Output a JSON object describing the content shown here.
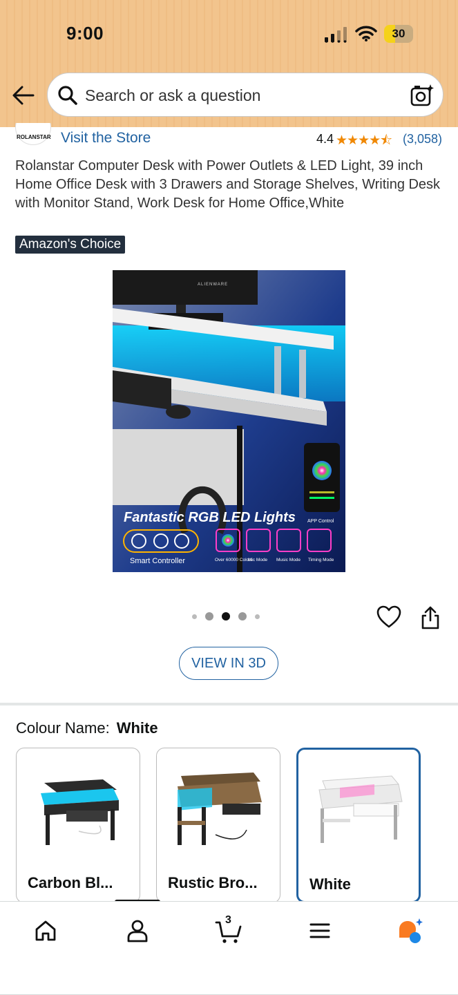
{
  "status_bar": {
    "time": "9:00",
    "battery": "30"
  },
  "search": {
    "placeholder": "Search or ask a question"
  },
  "store": {
    "logo_text": "ROLANSTAR",
    "link": "Visit the Store",
    "rating": "4.4",
    "stars": "★★★★⯪",
    "review_count": "(3,058)"
  },
  "product": {
    "title": "Rolanstar Computer Desk with Power Outlets & LED Light, 39 inch Home Office Desk with 3 Drawers and Storage Shelves, Writing Desk with Monitor Stand, Work Desk for Home Office,White",
    "badge": "Amazon's Choice"
  },
  "image": {
    "monitor_brand": "ALIENWARE",
    "headline": "Fantastic RGB LED Lights",
    "smart_controller": "Smart Controller",
    "app_control": "APP Control",
    "features": [
      "Over 60000 Colors",
      "Mic Mode",
      "Music Mode",
      "Timing Mode"
    ]
  },
  "carousel": {
    "count": 5,
    "active_index": 2
  },
  "view_3d": "VIEW IN 3D",
  "colour": {
    "label": "Colour Name:",
    "selected": "White",
    "options": [
      {
        "label": "Carbon Bl...",
        "color": "#2b2b2b"
      },
      {
        "label": "Rustic Bro...",
        "color": "#8a6a45"
      },
      {
        "label": "White",
        "color": "#f4f4f4"
      }
    ]
  },
  "cart_count": "3",
  "colors": {
    "link": "#2162a1",
    "star": "#f08804",
    "header": "#f2c48d",
    "badge": "#232f3e"
  }
}
